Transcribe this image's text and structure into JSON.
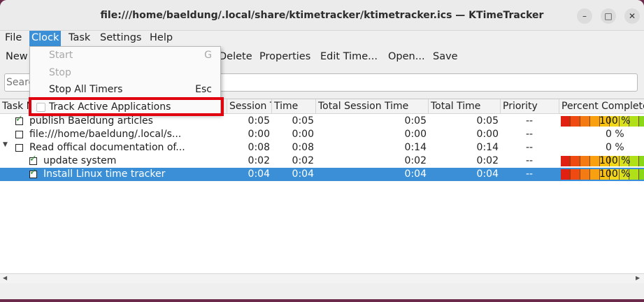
{
  "window": {
    "title": "file:///home/baeldung/.local/share/ktimetracker/ktimetracker.ics — KTimeTracker",
    "minimize_glyph": "–",
    "maximize_glyph": "□",
    "close_glyph": "✕"
  },
  "menubar": {
    "file": "File",
    "clock": "Clock",
    "task": "Task",
    "settings": "Settings",
    "help": "Help"
  },
  "toolbar": {
    "new": "New",
    "delete": "Delete",
    "properties": "Properties",
    "edit_time": "Edit Time...",
    "open": "Open...",
    "save": "Save"
  },
  "search": {
    "placeholder": "Search"
  },
  "table": {
    "headers": [
      "Task Name",
      "Session Time",
      "Time",
      "Total Session Time",
      "Total Time",
      "Priority",
      "Percent Complete"
    ],
    "rows": [
      {
        "name": "publish Baeldung articles",
        "checked": true,
        "session": "0:05",
        "time": "0:05",
        "total_session": "0:05",
        "total": "0:05",
        "priority": "--",
        "percent": "100 %",
        "bar": true
      },
      {
        "name": "file:///home/baeldung/.local/s...",
        "checked": false,
        "session": "0:00",
        "time": "0:00",
        "total_session": "0:00",
        "total": "0:00",
        "priority": "--",
        "percent": "0 %",
        "bar": false
      },
      {
        "name": "Read offical documentation of...",
        "checked": false,
        "session": "0:08",
        "time": "0:08",
        "total_session": "0:14",
        "total": "0:14",
        "priority": "--",
        "percent": "0 %",
        "bar": false
      },
      {
        "name": "update system",
        "checked": true,
        "session": "0:02",
        "time": "0:02",
        "total_session": "0:02",
        "total": "0:02",
        "priority": "--",
        "percent": "100 %",
        "bar": true
      },
      {
        "name": "Install Linux time tracker",
        "checked": true,
        "session": "0:04",
        "time": "0:04",
        "total_session": "0:04",
        "total": "0:04",
        "priority": "--",
        "percent": "100 %",
        "bar": true
      }
    ]
  },
  "clock_menu": {
    "start": "Start",
    "start_shortcut": "G",
    "stop": "Stop",
    "stop_all": "Stop All Timers",
    "stop_all_shortcut": "Esc",
    "track_active": "Track Active Applications"
  },
  "colors": {
    "accent": "#3a8fd6",
    "highlight_box": "#e0000e"
  }
}
